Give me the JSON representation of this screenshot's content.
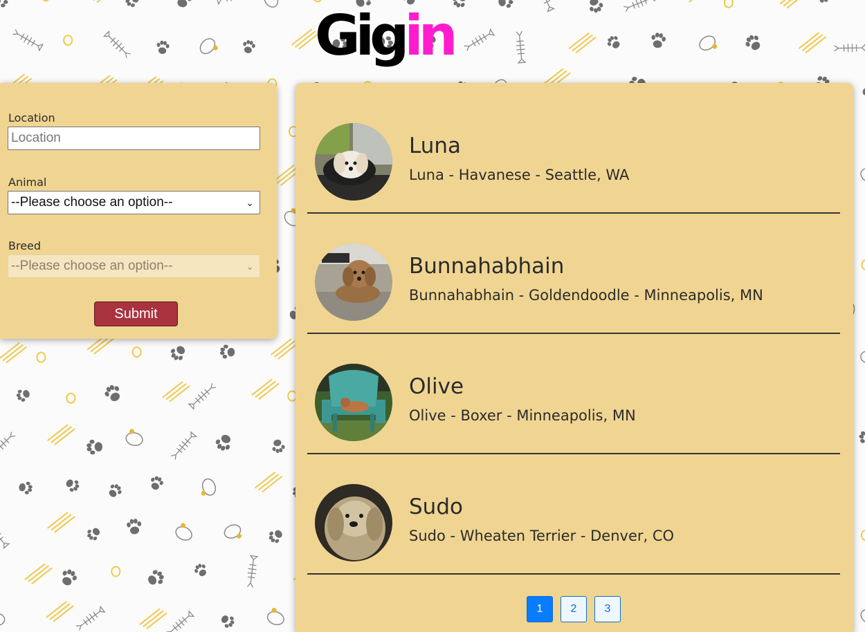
{
  "brand": {
    "logo_part1": "Gig",
    "logo_part2": "in"
  },
  "search_form": {
    "location_label": "Location",
    "location_placeholder": "Location",
    "animal_label": "Animal",
    "animal_selected": "--Please choose an option--",
    "breed_label": "Breed",
    "breed_selected": "--Please choose an option--",
    "submit_label": "Submit"
  },
  "results": [
    {
      "name": "Luna",
      "description": "Luna - Havanese - Seattle, WA"
    },
    {
      "name": "Bunnahabhain",
      "description": "Bunnahabhain - Goldendoodle - Minneapolis, MN"
    },
    {
      "name": "Olive",
      "description": "Olive - Boxer - Minneapolis, MN"
    },
    {
      "name": "Sudo",
      "description": "Sudo - Wheaten Terrier - Denver, CO"
    }
  ],
  "pagination": {
    "pages": [
      "1",
      "2",
      "3"
    ],
    "active": "1"
  },
  "colors": {
    "panel": "#f0d592",
    "logo_black": "#000000",
    "logo_pink": "#ff1ccf",
    "submit": "#a9323f",
    "page_active": "#0a7cff"
  },
  "icons": [
    "paw-print-icon",
    "fish-bone-icon",
    "pet-collar-icon",
    "chevron-down-icon"
  ]
}
